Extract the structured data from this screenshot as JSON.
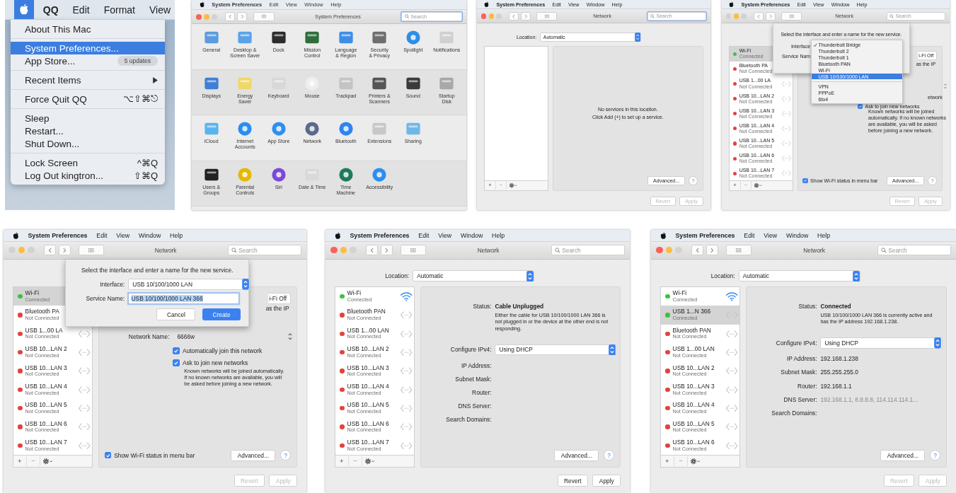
{
  "panels": [
    {
      "kind": "apple-menu",
      "menubar": {
        "apple_selected": true,
        "app": "QQ",
        "menus": [
          "Edit",
          "Format",
          "View"
        ]
      },
      "groups": [
        [
          {
            "label": "About This Mac",
            "selected": false,
            "submenu": false
          }
        ],
        [
          {
            "label": "System Preferences...",
            "selected": true,
            "submenu": false
          },
          {
            "label": "App Store...",
            "selected": false,
            "submenu": false,
            "badge": "5 updates"
          }
        ],
        [
          {
            "label": "Recent Items",
            "selected": false,
            "submenu": true
          }
        ],
        [
          {
            "label": "Force Quit QQ",
            "selected": false,
            "submenu": false,
            "shortcut": "⌥⇧⌘⎋"
          }
        ],
        [
          {
            "label": "Sleep",
            "selected": false,
            "submenu": false
          },
          {
            "label": "Restart...",
            "selected": false,
            "submenu": false
          },
          {
            "label": "Shut Down...",
            "selected": false,
            "submenu": false
          }
        ],
        [
          {
            "label": "Lock Screen",
            "selected": false,
            "submenu": false,
            "shortcut": "^⌘Q"
          },
          {
            "label": "Log Out kingtron...",
            "selected": false,
            "submenu": false,
            "shortcut": "⇧⌘Q"
          }
        ]
      ]
    },
    {
      "kind": "preferences",
      "menubar": {
        "apple_selected": false,
        "app": "System Preferences",
        "menus": [
          "Edit",
          "View",
          "Window",
          "Help"
        ]
      },
      "window": {
        "title": "System Preferences",
        "close_enabled": true,
        "search": {
          "placeholder": "Search",
          "focused": true
        }
      },
      "rows": [
        [
          "General",
          "Desktop &\nScreen Saver",
          "Dock",
          "Mission\nControl",
          "Language\n& Region",
          "Security\n& Privacy",
          "Spotlight",
          "Notifications"
        ],
        [
          "Displays",
          "Energy\nSaver",
          "Keyboard",
          "Mouse",
          "Trackpad",
          "Printers &\nScanners",
          "Sound",
          "Startup\nDisk"
        ],
        [
          "iCloud",
          "Internet\nAccounts",
          "App Store",
          "Network",
          "Bluetooth",
          "Extensions",
          "Sharing"
        ],
        [
          "Users &\nGroups",
          "Parental\nControls",
          "Siri",
          "Date & Time",
          "Time\nMachine",
          "Accessibility"
        ]
      ]
    },
    {
      "kind": "network",
      "menubar": {
        "apple_selected": false,
        "app": "System Preferences",
        "menus": [
          "Edit",
          "View",
          "Window",
          "Help"
        ]
      },
      "window": {
        "title": "Network",
        "close_enabled": true,
        "search": {
          "placeholder": "Search",
          "focused": true
        }
      },
      "location": {
        "label": "Location:",
        "value": "Automatic"
      },
      "list_tools": [
        "+",
        "−"
      ],
      "detail": {
        "kind": "empty",
        "message": "No services in this location.\nClick Add (+) to set up a service."
      },
      "advanced": "Advanced...",
      "help": "?",
      "footer": [
        {
          "label": "Revert",
          "disabled": true
        },
        {
          "label": "Apply",
          "disabled": true
        }
      ]
    },
    {
      "kind": "network",
      "menubar": {
        "apple_selected": false,
        "app": "System Preferences",
        "menus": [
          "Edit",
          "View",
          "Window",
          "Help"
        ]
      },
      "window": {
        "title": "Network",
        "close_enabled": false,
        "search": {
          "placeholder": "Search",
          "focused": false
        }
      },
      "services": [
        {
          "name": "Wi-Fi",
          "status": "Connected",
          "color": "#3ec23e",
          "kind": "plain",
          "selected": true
        },
        {
          "name": "Bluetooth PA",
          "status": "Not Connected",
          "color": "#e0443e",
          "kind": "plain",
          "selected": false
        },
        {
          "name": "USB 1...00 LA",
          "status": "Not Connected",
          "color": "#e0443e",
          "kind": "ethernet",
          "selected": false
        },
        {
          "name": "USB 10...LAN 2",
          "status": "Not Connected",
          "color": "#e0443e",
          "kind": "ethernet",
          "selected": false
        },
        {
          "name": "USB 10...LAN 3",
          "status": "Not Connected",
          "color": "#e0443e",
          "kind": "ethernet",
          "selected": false
        },
        {
          "name": "USB 10...LAN 4",
          "status": "Not Connected",
          "color": "#e0443e",
          "kind": "ethernet",
          "selected": false
        },
        {
          "name": "USB 10...LAN 5",
          "status": "Not Connected",
          "color": "#e0443e",
          "kind": "ethernet",
          "selected": false
        },
        {
          "name": "USB 10...LAN 6",
          "status": "Not Connected",
          "color": "#e0443e",
          "kind": "ethernet",
          "selected": false
        },
        {
          "name": "USB 10...LAN 7",
          "status": "Not Connected",
          "color": "#e0443e",
          "kind": "ethernet",
          "selected": false
        }
      ],
      "list_tools": [
        "+",
        "−"
      ],
      "detail": {
        "kind": "wifi",
        "power_button": "i-Fi Off",
        "status_tail": "as the IP",
        "network_arrows": true,
        "join_tail": "etwork",
        "options": [
          {
            "label": "Ask to join new networks",
            "checked": true
          }
        ],
        "note": "Known networks will be joined automatically. If no known networks are available, you will be asked before joining a new network.",
        "show_status": {
          "label": "Show Wi-Fi status in menu bar",
          "checked": true
        }
      },
      "advanced": "Advanced...",
      "help": "?",
      "footer": [
        {
          "label": "Revert",
          "disabled": true
        },
        {
          "label": "Apply",
          "disabled": true
        }
      ],
      "sheet": {
        "kind": "menu",
        "prompt": "Select the interface and enter a name for the new service.",
        "interface_label": "Interface",
        "name_label": "Service Nam",
        "menu": [
          [
            {
              "label": "Thunderbolt Bridge",
              "checked": true,
              "selected": false
            },
            {
              "label": "Thunderbolt 2",
              "checked": false,
              "selected": false
            },
            {
              "label": "Thunderbolt 1",
              "checked": false,
              "selected": false
            },
            {
              "label": "Bluetooth PAN",
              "checked": false,
              "selected": false
            },
            {
              "label": "Wi-Fi",
              "checked": false,
              "selected": false
            },
            {
              "label": "USB 10/100/1000 LAN",
              "checked": false,
              "selected": true
            }
          ],
          [
            {
              "label": "VPN",
              "checked": false,
              "selected": false
            },
            {
              "label": "PPPoE",
              "checked": false,
              "selected": false
            },
            {
              "label": "6to4",
              "checked": false,
              "selected": false
            }
          ]
        ]
      }
    },
    {
      "kind": "network",
      "menubar": {
        "apple_selected": false,
        "app": "System Preferences",
        "menus": [
          "Edit",
          "View",
          "Window",
          "Help"
        ]
      },
      "window": {
        "title": "Network",
        "close_enabled": false,
        "search": {
          "placeholder": "Search",
          "focused": false
        }
      },
      "services": [
        {
          "name": "Wi-Fi",
          "status": "Connected",
          "color": "#3ec23e",
          "kind": "plain",
          "selected": true
        },
        {
          "name": "Bluetooth PA",
          "status": "Not Connected",
          "color": "#e0443e",
          "kind": "plain",
          "selected": false
        },
        {
          "name": "USB 1...00 LA",
          "status": "Not Connected",
          "color": "#e0443e",
          "kind": "ethernet",
          "selected": false
        },
        {
          "name": "USB 10...LAN 2",
          "status": "Not Connected",
          "color": "#e0443e",
          "kind": "ethernet",
          "selected": false
        },
        {
          "name": "USB 10...LAN 3",
          "status": "Not Connected",
          "color": "#e0443e",
          "kind": "ethernet",
          "selected": false
        },
        {
          "name": "USB 10...LAN 4",
          "status": "Not Connected",
          "color": "#e0443e",
          "kind": "ethernet",
          "selected": false
        },
        {
          "name": "USB 10...LAN 5",
          "status": "Not Connected",
          "color": "#e0443e",
          "kind": "ethernet",
          "selected": false
        },
        {
          "name": "USB 10...LAN 6",
          "status": "Not Connected",
          "color": "#e0443e",
          "kind": "ethernet",
          "selected": false
        },
        {
          "name": "USB 10...LAN 7",
          "status": "Not Connected",
          "color": "#e0443e",
          "kind": "ethernet",
          "selected": false
        }
      ],
      "list_tools": [
        "+",
        "−"
      ],
      "detail": {
        "kind": "wifi",
        "power_button": "i-Fi Off",
        "status_tail": "as the IP",
        "network_name": {
          "label": "Network Name:",
          "value": "6666w"
        },
        "options": [
          {
            "label": "Automatically join this network",
            "checked": true
          },
          {
            "label": "Ask to join new networks",
            "checked": true
          }
        ],
        "note": "Known networks will be joined automatically. If no known networks are available, you will be asked before joining a new network.",
        "show_status": {
          "label": "Show Wi-Fi status in menu bar",
          "checked": true
        }
      },
      "advanced": "Advanced...",
      "help": "?",
      "footer": [
        {
          "label": "Revert",
          "disabled": true
        },
        {
          "label": "Apply",
          "disabled": true
        }
      ],
      "sheet": {
        "kind": "form",
        "prompt": "Select the interface and enter a name for the new service.",
        "interface_label": "Interface:",
        "interface": "USB 10/100/1000 LAN",
        "name_label": "Service Name:",
        "name": "USB 10/100/1000 LAN 366",
        "name_selected": true,
        "buttons": [
          {
            "label": "Cancel",
            "default": false
          },
          {
            "label": "Create",
            "default": true
          }
        ]
      }
    },
    {
      "kind": "network",
      "menubar": {
        "apple_selected": false,
        "app": "System Preferences",
        "menus": [
          "Edit",
          "View",
          "Window",
          "Help"
        ]
      },
      "window": {
        "title": "Network",
        "close_enabled": true,
        "search": {
          "placeholder": "Search",
          "focused": false
        }
      },
      "location": {
        "label": "Location:",
        "value": "Automatic"
      },
      "services": [
        {
          "name": "Wi-Fi",
          "status": "Connected",
          "color": "#3ec23e",
          "kind": "wifi",
          "selected": false
        },
        {
          "name": "Bluetooth PAN",
          "status": "Not Connected",
          "color": "#e0443e",
          "kind": "ethernet",
          "selected": false
        },
        {
          "name": "USB 1...00 LAN",
          "status": "Not Connected",
          "color": "#e0443e",
          "kind": "ethernet",
          "selected": false
        },
        {
          "name": "USB 10...LAN 2",
          "status": "Not Connected",
          "color": "#e0443e",
          "kind": "ethernet",
          "selected": false
        },
        {
          "name": "USB 10...LAN 3",
          "status": "Not Connected",
          "color": "#e0443e",
          "kind": "ethernet",
          "selected": false
        },
        {
          "name": "USB 10...LAN 4",
          "status": "Not Connected",
          "color": "#e0443e",
          "kind": "ethernet",
          "selected": false
        },
        {
          "name": "USB 10...LAN 5",
          "status": "Not Connected",
          "color": "#e0443e",
          "kind": "ethernet",
          "selected": false
        },
        {
          "name": "USB 10...LAN 6",
          "status": "Not Connected",
          "color": "#e0443e",
          "kind": "ethernet",
          "selected": false
        },
        {
          "name": "USB 10...LAN 7",
          "status": "Not Connected",
          "color": "#e0443e",
          "kind": "ethernet",
          "selected": false
        }
      ],
      "list_tools": [
        "+",
        "−"
      ],
      "detail": {
        "kind": "status",
        "status_label": "Status:",
        "status": "Cable Unplugged",
        "description": "Either the cable for USB 10/100/1000 LAN 366 is not plugged in or the device at the other end is not responding.",
        "fields": [
          {
            "label": "Configure IPv4:",
            "kind": "popup",
            "value": "Using DHCP"
          },
          {
            "label": "IP Address:",
            "kind": "text"
          },
          {
            "label": "Subnet Mask:",
            "kind": "text"
          },
          {
            "label": "Router:",
            "kind": "text"
          },
          {
            "label": "DNS Server:",
            "kind": "text"
          },
          {
            "label": "Search Domains:",
            "kind": "text"
          }
        ]
      },
      "advanced": "Advanced...",
      "help": "?",
      "footer": [
        {
          "label": "Revert",
          "disabled": false
        },
        {
          "label": "Apply",
          "disabled": false
        }
      ]
    },
    {
      "kind": "network",
      "menubar": {
        "apple_selected": false,
        "app": "System Preferences",
        "menus": [
          "Edit",
          "View",
          "Window",
          "Help"
        ]
      },
      "window": {
        "title": "Network",
        "close_enabled": true,
        "search": {
          "placeholder": "Search",
          "focused": false
        }
      },
      "location": {
        "label": "Location:",
        "value": "Automatic"
      },
      "services": [
        {
          "name": "Wi-Fi",
          "status": "Connected",
          "color": "#3ec23e",
          "kind": "wifi",
          "selected": false
        },
        {
          "name": "USB 1...N 366",
          "status": "Connected",
          "color": "#3ec23e",
          "kind": "ethernet",
          "selected": true
        },
        {
          "name": "Bluetooth PAN",
          "status": "Not Connected",
          "color": "#e0443e",
          "kind": "ethernet",
          "selected": false
        },
        {
          "name": "USB 1...00 LAN",
          "status": "Not Connected",
          "color": "#e0443e",
          "kind": "ethernet",
          "selected": false
        },
        {
          "name": "USB 10...LAN 2",
          "status": "Not Connected",
          "color": "#e0443e",
          "kind": "ethernet",
          "selected": false
        },
        {
          "name": "USB 10...LAN 3",
          "status": "Not Connected",
          "color": "#e0443e",
          "kind": "ethernet",
          "selected": false
        },
        {
          "name": "USB 10...LAN 4",
          "status": "Not Connected",
          "color": "#e0443e",
          "kind": "ethernet",
          "selected": false
        },
        {
          "name": "USB 10...LAN 5",
          "status": "Not Connected",
          "color": "#e0443e",
          "kind": "ethernet",
          "selected": false
        },
        {
          "name": "USB 10...LAN 6",
          "status": "Not Connected",
          "color": "#e0443e",
          "kind": "ethernet",
          "selected": false
        }
      ],
      "list_tools": [
        "+",
        "−"
      ],
      "detail": {
        "kind": "status",
        "status_label": "Status:",
        "status": "Connected",
        "description": "USB 10/100/1000 LAN 366 is currently active and has the IP address 192.168.1.238.",
        "fields": [
          {
            "label": "Configure IPv4:",
            "kind": "popup",
            "value": "Using DHCP"
          },
          {
            "label": "IP Address:",
            "kind": "text",
            "value": "192.168.1.238",
            "dimmed": false
          },
          {
            "label": "Subnet Mask:",
            "kind": "text",
            "value": "255.255.255.0",
            "dimmed": false
          },
          {
            "label": "Router:",
            "kind": "text",
            "value": "192.168.1.1",
            "dimmed": false
          },
          {
            "label": "DNS Server:",
            "kind": "text",
            "value": "192.168.1.1, 8.8.8.8, 114.114.114.1...",
            "dimmed": true
          },
          {
            "label": "Search Domains:",
            "kind": "text"
          }
        ]
      },
      "advanced": "Advanced...",
      "help": "?",
      "footer": [
        {
          "label": "Revert",
          "disabled": true
        },
        {
          "label": "Apply",
          "disabled": true
        }
      ]
    }
  ]
}
